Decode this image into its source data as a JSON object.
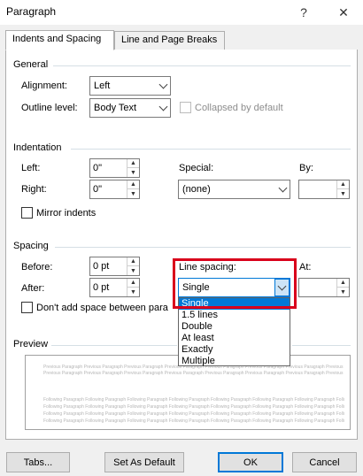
{
  "window": {
    "title": "Paragraph",
    "help_symbol": "?",
    "close_symbol": "✕"
  },
  "tabs": [
    {
      "label": "Indents and Spacing",
      "active": true
    },
    {
      "label": "Line and Page Breaks",
      "active": false
    }
  ],
  "general": {
    "section_label": "General",
    "alignment_label": "Alignment:",
    "alignment_value": "Left",
    "outline_label": "Outline level:",
    "outline_value": "Body Text",
    "collapsed_label": "Collapsed by default"
  },
  "indentation": {
    "section_label": "Indentation",
    "left_label": "Left:",
    "left_value": "0\"",
    "right_label": "Right:",
    "right_value": "0\"",
    "special_label": "Special:",
    "special_value": "(none)",
    "by_label": "By:",
    "by_value": "",
    "mirror_label": "Mirror indents"
  },
  "spacing": {
    "section_label": "Spacing",
    "before_label": "Before:",
    "before_value": "0 pt",
    "after_label": "After:",
    "after_value": "0 pt",
    "line_spacing_label": "Line spacing:",
    "line_spacing_value": "Single",
    "at_label": "At:",
    "at_value": "",
    "dont_add_label": "Don't add space between para",
    "options": [
      "Single",
      "1.5 lines",
      "Double",
      "At least",
      "Exactly",
      "Multiple"
    ],
    "selected_option": "Single"
  },
  "preview": {
    "section_label": "Preview",
    "previous_text": "Previous Paragraph Previous Paragraph Previous Paragraph Previous Paragraph Previous Paragraph Previous Paragraph Previous Paragraph Previous Paragraph",
    "following_text": "Following Paragraph Following Paragraph Following Paragraph Following Paragraph Following Paragraph Following Paragraph Following Paragraph Following Paragraph"
  },
  "buttons": {
    "tabs": "Tabs...",
    "set_default": "Set As Default",
    "ok": "OK",
    "cancel": "Cancel"
  },
  "colors": {
    "accent": "#0078d7",
    "highlight_box": "#d9001b"
  },
  "icons": {
    "spin_up": "▲",
    "spin_down": "▼"
  }
}
